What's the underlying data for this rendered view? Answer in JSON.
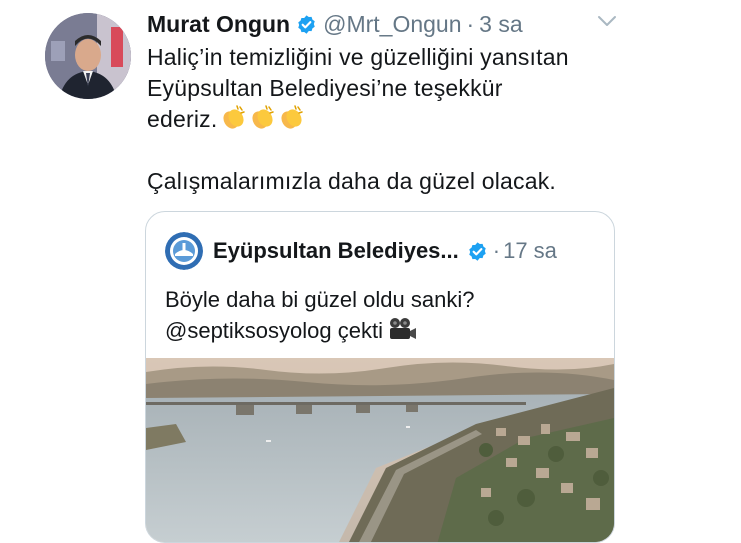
{
  "tweet": {
    "author_name": "Murat Ongun",
    "handle": "@Mrt_Ongun",
    "separator": "·",
    "time": "3 sa",
    "text_line1": "Haliç’in temizliğini ve güzelliğini yansıtan",
    "text_line2": "Eyüpsultan Belediyesi’ne teşekkür",
    "text_line3": "ederiz.",
    "text_line4": "Çalışmalarımızla daha da güzel olacak.",
    "emoji": [
      "clapping-hands",
      "clapping-hands",
      "clapping-hands"
    ]
  },
  "quoted": {
    "author_name": "Eyüpsultan Belediyes...",
    "separator": "·",
    "time": "17 sa",
    "text_line1": "Böyle daha bi güzel oldu sanki?",
    "text_line2": "@septiksosyolog çekti",
    "emoji": "movie-camera"
  },
  "colors": {
    "text": "#14171a",
    "secondary": "#657786",
    "verified": "#1da1f2",
    "border": "#ccd6dd"
  }
}
